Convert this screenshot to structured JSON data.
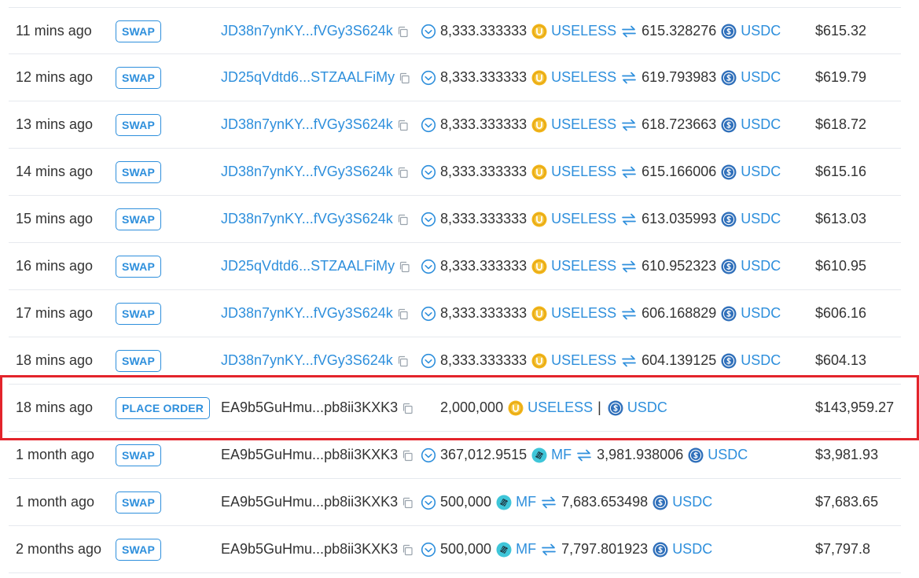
{
  "colors": {
    "link": "#2e8fdc",
    "text": "#333333",
    "highlight": "#e3242b",
    "useless_token": "#f2b519",
    "usdc_token": "#2f6fba",
    "mf_token": "#3fc6d9"
  },
  "icons": {
    "copy": "copy-icon",
    "check": "check-circle-icon",
    "swap": "swap-arrows-icon",
    "useless": "useless-token-icon",
    "usdc": "usdc-token-icon",
    "mf": "mf-token-icon"
  },
  "rows": [
    {
      "time": "11 mins ago",
      "type": "SWAP",
      "addr": "JD38n7ynKY...fVGy3S624k",
      "addr_link": true,
      "kind": "swap",
      "from_amount": "8,333.333333",
      "from_token": "USELESS",
      "from_icon": "useless",
      "to_amount": "615.328276",
      "to_token": "USDC",
      "to_icon": "usdc",
      "value": "$615.32"
    },
    {
      "time": "12 mins ago",
      "type": "SWAP",
      "addr": "JD25qVdtd6...STZAALFiMy",
      "addr_link": true,
      "kind": "swap",
      "from_amount": "8,333.333333",
      "from_token": "USELESS",
      "from_icon": "useless",
      "to_amount": "619.793983",
      "to_token": "USDC",
      "to_icon": "usdc",
      "value": "$619.79"
    },
    {
      "time": "13 mins ago",
      "type": "SWAP",
      "addr": "JD38n7ynKY...fVGy3S624k",
      "addr_link": true,
      "kind": "swap",
      "from_amount": "8,333.333333",
      "from_token": "USELESS",
      "from_icon": "useless",
      "to_amount": "618.723663",
      "to_token": "USDC",
      "to_icon": "usdc",
      "value": "$618.72"
    },
    {
      "time": "14 mins ago",
      "type": "SWAP",
      "addr": "JD38n7ynKY...fVGy3S624k",
      "addr_link": true,
      "kind": "swap",
      "from_amount": "8,333.333333",
      "from_token": "USELESS",
      "from_icon": "useless",
      "to_amount": "615.166006",
      "to_token": "USDC",
      "to_icon": "usdc",
      "value": "$615.16"
    },
    {
      "time": "15 mins ago",
      "type": "SWAP",
      "addr": "JD38n7ynKY...fVGy3S624k",
      "addr_link": true,
      "kind": "swap",
      "from_amount": "8,333.333333",
      "from_token": "USELESS",
      "from_icon": "useless",
      "to_amount": "613.035993",
      "to_token": "USDC",
      "to_icon": "usdc",
      "value": "$613.03"
    },
    {
      "time": "16 mins ago",
      "type": "SWAP",
      "addr": "JD25qVdtd6...STZAALFiMy",
      "addr_link": true,
      "kind": "swap",
      "from_amount": "8,333.333333",
      "from_token": "USELESS",
      "from_icon": "useless",
      "to_amount": "610.952323",
      "to_token": "USDC",
      "to_icon": "usdc",
      "value": "$610.95"
    },
    {
      "time": "17 mins ago",
      "type": "SWAP",
      "addr": "JD38n7ynKY...fVGy3S624k",
      "addr_link": true,
      "kind": "swap",
      "from_amount": "8,333.333333",
      "from_token": "USELESS",
      "from_icon": "useless",
      "to_amount": "606.168829",
      "to_token": "USDC",
      "to_icon": "usdc",
      "value": "$606.16"
    },
    {
      "time": "18 mins ago",
      "type": "SWAP",
      "addr": "JD38n7ynKY...fVGy3S624k",
      "addr_link": true,
      "kind": "swap",
      "from_amount": "8,333.333333",
      "from_token": "USELESS",
      "from_icon": "useless",
      "to_amount": "604.139125",
      "to_token": "USDC",
      "to_icon": "usdc",
      "value": "$604.13"
    },
    {
      "time": "18 mins ago",
      "type": "PLACE ORDER",
      "addr": "EA9b5GuHmu...pb8ii3KXK3",
      "addr_link": false,
      "kind": "order",
      "from_amount": "2,000,000",
      "from_token": "USELESS",
      "from_icon": "useless",
      "separator": "|",
      "to_token": "USDC",
      "to_icon": "usdc",
      "value": "$143,959.27"
    },
    {
      "time": "1 month ago",
      "type": "SWAP",
      "addr": "EA9b5GuHmu...pb8ii3KXK3",
      "addr_link": false,
      "kind": "swap",
      "from_amount": "367,012.9515",
      "from_token": "MF",
      "from_icon": "mf",
      "to_amount": "3,981.938006",
      "to_token": "USDC",
      "to_icon": "usdc",
      "value": "$3,981.93"
    },
    {
      "time": "1 month ago",
      "type": "SWAP",
      "addr": "EA9b5GuHmu...pb8ii3KXK3",
      "addr_link": false,
      "kind": "swap",
      "from_amount": "500,000",
      "from_token": "MF",
      "from_icon": "mf",
      "to_amount": "7,683.653498",
      "to_token": "USDC",
      "to_icon": "usdc",
      "value": "$7,683.65"
    },
    {
      "time": "2 months ago",
      "type": "SWAP",
      "addr": "EA9b5GuHmu...pb8ii3KXK3",
      "addr_link": false,
      "kind": "swap",
      "from_amount": "500,000",
      "from_token": "MF",
      "from_icon": "mf",
      "to_amount": "7,797.801923",
      "to_token": "USDC",
      "to_icon": "usdc",
      "value": "$7,797.8"
    }
  ]
}
